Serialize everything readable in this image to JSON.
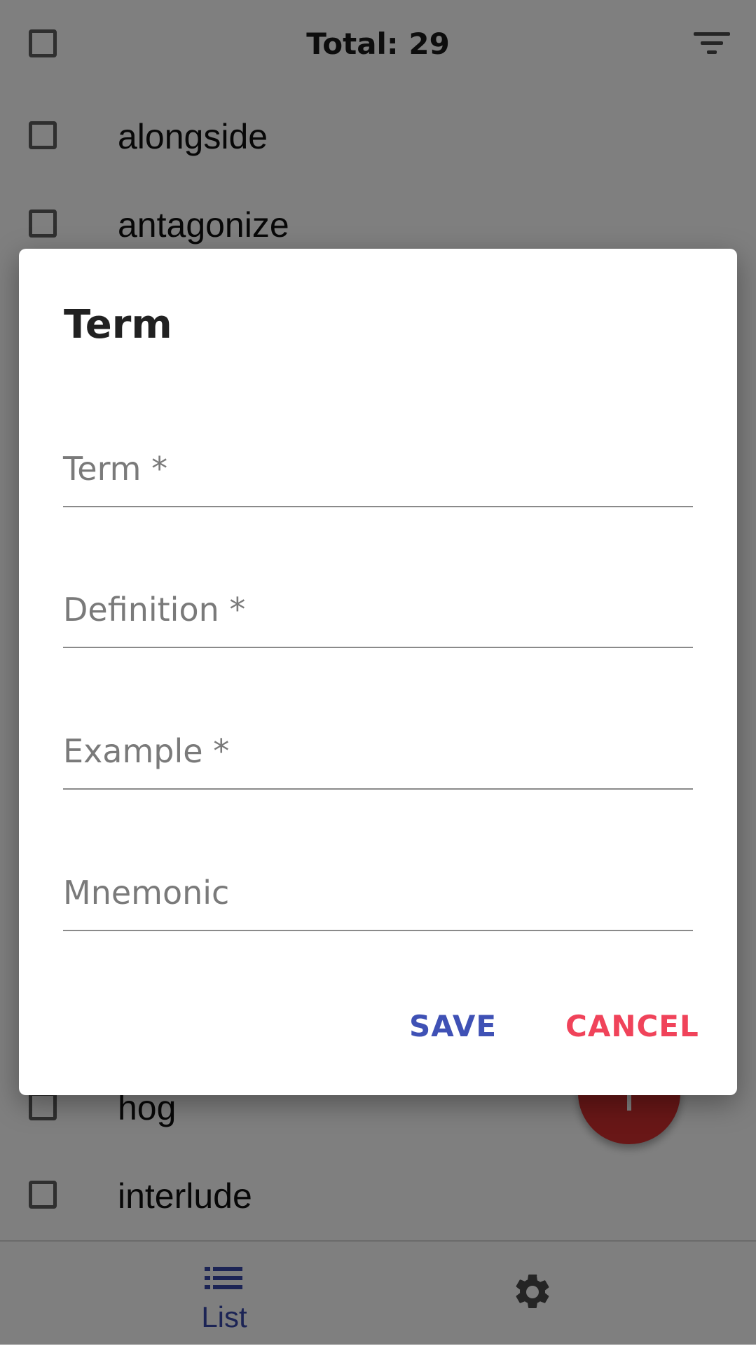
{
  "header": {
    "total_label": "Total: 29"
  },
  "list": {
    "items": [
      {
        "word": "alongside",
        "checked": false
      },
      {
        "word": "antagonize",
        "checked": false
      },
      {
        "word": "hog",
        "checked": false
      },
      {
        "word": "interlude",
        "checked": false
      }
    ]
  },
  "bottom_nav": {
    "list_label": "List"
  },
  "dialog": {
    "title": "Term",
    "fields": {
      "term_label": "Term *",
      "definition_label": "Definition *",
      "example_label": "Example *",
      "mnemonic_label": "Mnemonic"
    },
    "save_label": "SAVE",
    "cancel_label": "CANCEL"
  },
  "colors": {
    "accent": "#3f51b5",
    "cancel": "#f0435a",
    "fab": "#d32f2f"
  },
  "icons": {
    "filter": "filter-icon",
    "list": "list-icon",
    "settings": "gear-icon",
    "add": "plus-icon"
  }
}
